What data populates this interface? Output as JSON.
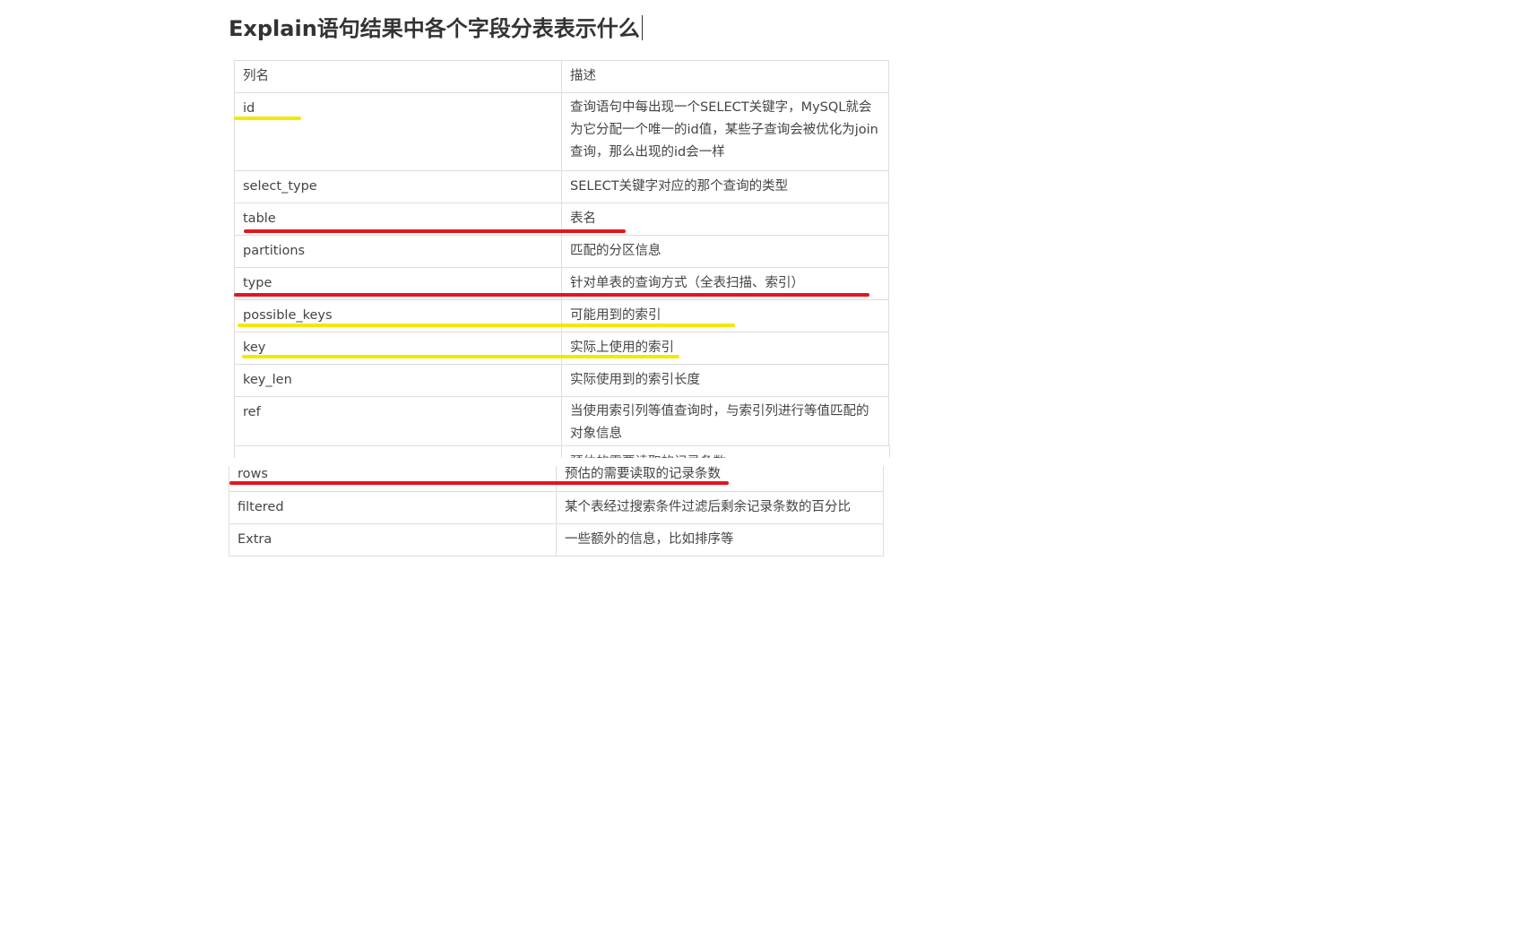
{
  "title": "Explain语句结果中各个字段分表表示什么",
  "table": {
    "headers": [
      "列名",
      "描述"
    ],
    "rows": [
      {
        "name": "id",
        "desc": "查询语句中每出现一个SELECT关键字，MySQL就会为它分配一个唯一的id值，某些子查询会被优化为join查询，那么出现的id会一样"
      },
      {
        "name": "select_type",
        "desc": "SELECT关键字对应的那个查询的类型"
      },
      {
        "name": "table",
        "desc": "表名"
      },
      {
        "name": "partitions",
        "desc": "匹配的分区信息"
      },
      {
        "name": "type",
        "desc": "针对单表的查询方式（全表扫描、索引）"
      },
      {
        "name": "possible_keys",
        "desc": "可能用到的索引"
      },
      {
        "name": "key",
        "desc": "实际上使用的索引"
      },
      {
        "name": "key_len",
        "desc": "实际使用到的索引长度"
      },
      {
        "name": "ref",
        "desc": "当使用索引列等值查询时，与索引列进行等值匹配的对象信息"
      },
      {
        "name": "rows",
        "desc": "预估的需要读取的记录条数"
      },
      {
        "name": "filtered",
        "desc": "某个表经过搜索条件过滤后剩余记录条数的百分比"
      },
      {
        "name": "Extra",
        "desc": "一些额外的信息，比如排序等"
      }
    ]
  },
  "annotation_colors": {
    "yellow": "#f5e800",
    "red": "#e3151f"
  }
}
